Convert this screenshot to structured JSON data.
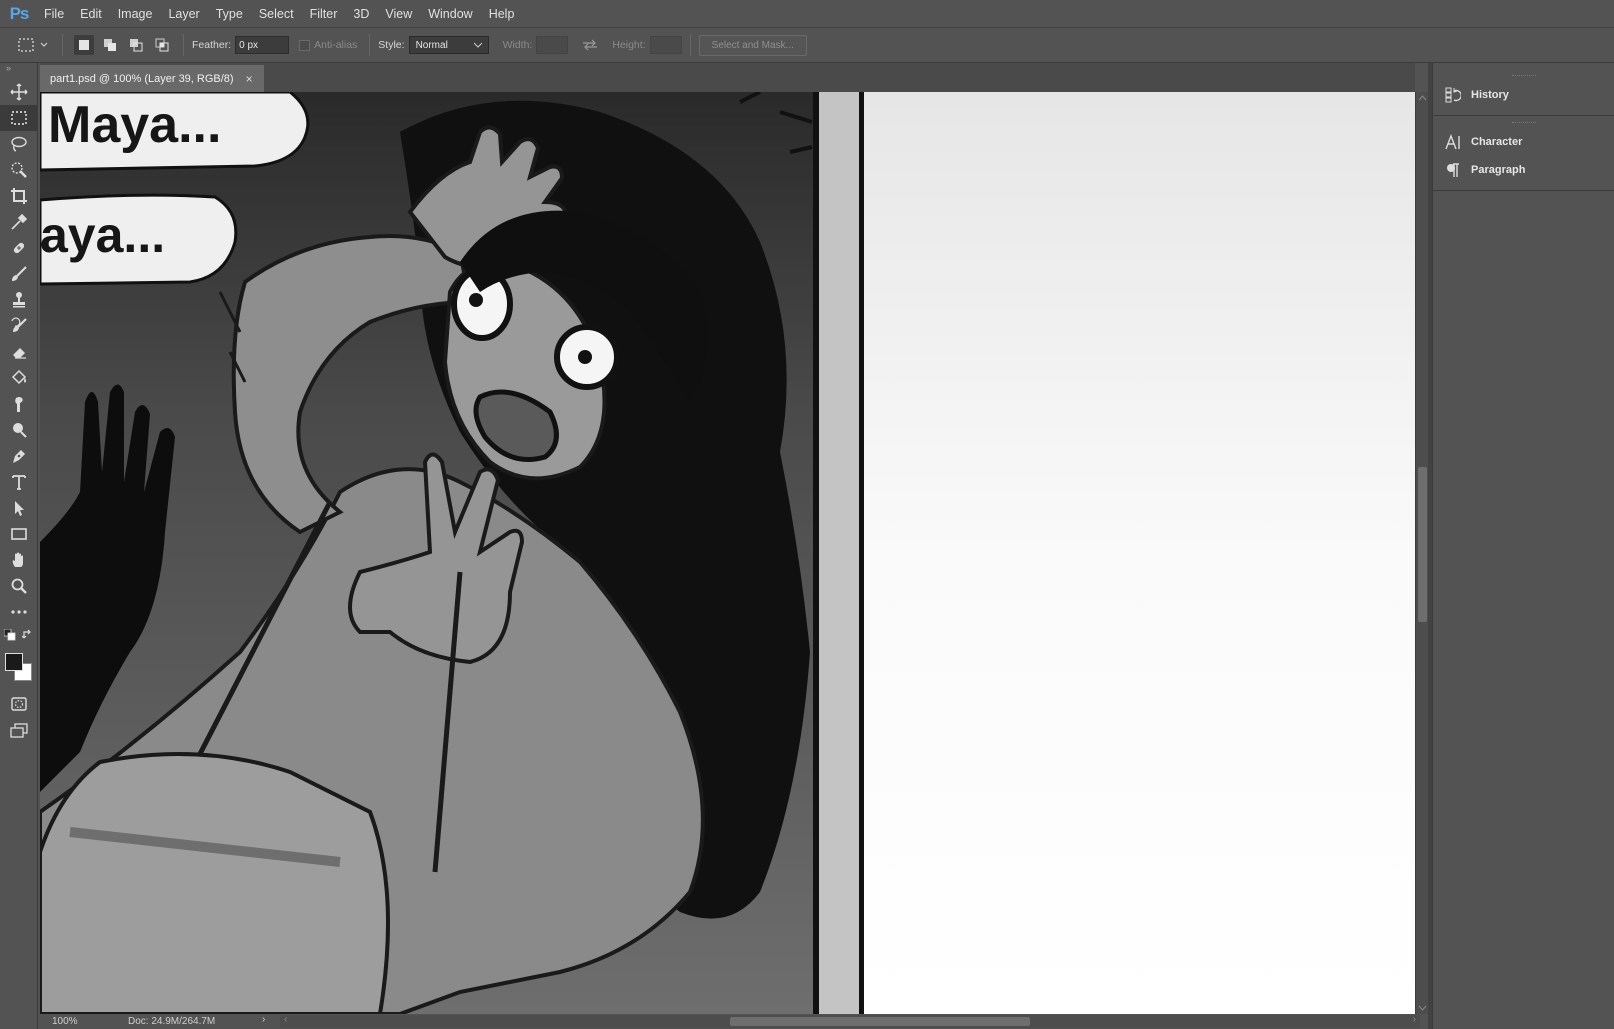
{
  "app": {
    "logo": "Ps"
  },
  "menu": [
    "File",
    "Edit",
    "Image",
    "Layer",
    "Type",
    "Select",
    "Filter",
    "3D",
    "View",
    "Window",
    "Help"
  ],
  "options": {
    "feather_label": "Feather:",
    "feather_value": "0 px",
    "antialias_label": "Anti-alias",
    "style_label": "Style:",
    "style_value": "Normal",
    "width_label": "Width:",
    "height_label": "Height:",
    "mask_button": "Select and Mask..."
  },
  "document": {
    "tab_title": "part1.psd @ 100% (Layer 39, RGB/8)",
    "close_glyph": "×"
  },
  "artwork": {
    "bubble_1": "Maya...",
    "bubble_2": "aya..."
  },
  "status": {
    "zoom": "100%",
    "doc_size": "Doc: 24.9M/264.7M"
  },
  "panels": {
    "history": "History",
    "character": "Character",
    "paragraph": "Paragraph"
  },
  "tools": [
    "move-tool",
    "rectangular-marquee-tool",
    "lasso-tool",
    "quick-selection-tool",
    "crop-tool",
    "eyedropper-tool",
    "healing-brush-tool",
    "brush-tool",
    "clone-stamp-tool",
    "history-brush-tool",
    "eraser-tool",
    "paint-bucket-tool",
    "smudge-tool",
    "dodge-tool",
    "pen-tool",
    "type-tool",
    "path-selection-tool",
    "rectangle-tool",
    "hand-tool",
    "zoom-tool",
    "edit-toolbar"
  ],
  "colors": {
    "foreground": "#1a1a1a",
    "background": "#ffffff",
    "ui_bg": "#535353",
    "ps_blue": "#5aa6e6"
  }
}
